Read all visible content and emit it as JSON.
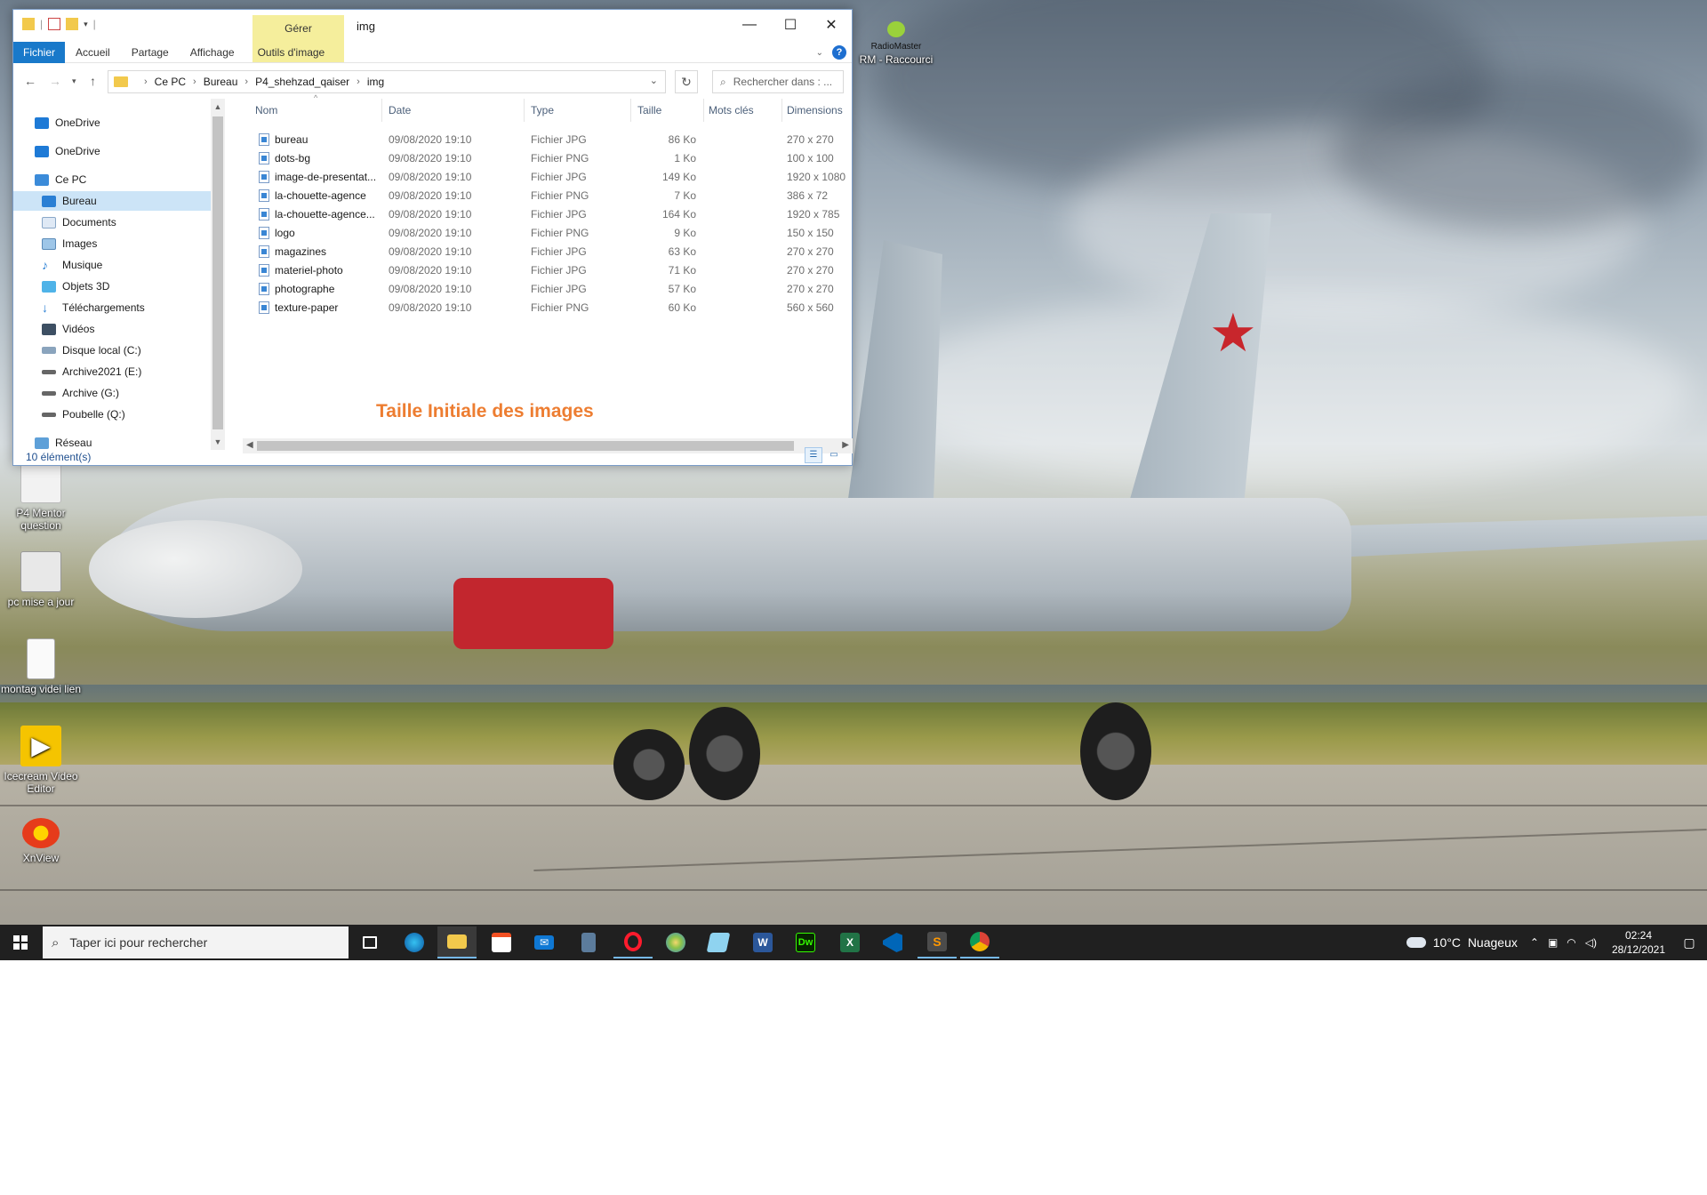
{
  "desktop": {
    "icons": [
      {
        "label": "RadioMaster",
        "sub": "RM - Raccourci"
      },
      {
        "label": "P4 Mentor question"
      },
      {
        "label": "pc mise a jour"
      },
      {
        "label": "montag videi lien"
      },
      {
        "label": "Icecream Video Editor"
      },
      {
        "label": "XnView"
      }
    ]
  },
  "explorer": {
    "title": "img",
    "context_tab": "Gérer",
    "ribbon_tabs": [
      "Fichier",
      "Accueil",
      "Partage",
      "Affichage",
      "Outils d'image"
    ],
    "address": {
      "crumbs": [
        "Ce PC",
        "Bureau",
        "P4_shehzad_qaiser",
        "img"
      ]
    },
    "search_placeholder": "Rechercher dans : ...",
    "nav_items": [
      {
        "label": "OneDrive",
        "icon": "onedrive-icon"
      },
      {
        "label": "OneDrive",
        "icon": "onedrive-icon"
      },
      {
        "label": "Ce PC",
        "icon": "this-pc-icon"
      },
      {
        "label": "Bureau",
        "icon": "desktop-folder-icon",
        "selected": true
      },
      {
        "label": "Documents",
        "icon": "documents-icon"
      },
      {
        "label": "Images",
        "icon": "pictures-icon"
      },
      {
        "label": "Musique",
        "icon": "music-icon"
      },
      {
        "label": "Objets 3D",
        "icon": "3d-objects-icon"
      },
      {
        "label": "Téléchargements",
        "icon": "downloads-icon"
      },
      {
        "label": "Vidéos",
        "icon": "videos-icon"
      },
      {
        "label": "Disque local (C:)",
        "icon": "local-disk-icon"
      },
      {
        "label": "Archive2021 (E:)",
        "icon": "drive-icon"
      },
      {
        "label": "Archive (G:)",
        "icon": "drive-icon"
      },
      {
        "label": "Poubelle (Q:)",
        "icon": "drive-icon"
      },
      {
        "label": "Réseau",
        "icon": "network-icon"
      }
    ],
    "columns": {
      "name": "Nom",
      "date": "Date",
      "type": "Type",
      "size": "Taille",
      "tags": "Mots clés",
      "dimensions": "Dimensions"
    },
    "files": [
      {
        "name": "bureau",
        "date": "09/08/2020 19:10",
        "type": "Fichier JPG",
        "size": "86 Ko",
        "dimensions": "270 x 270"
      },
      {
        "name": "dots-bg",
        "date": "09/08/2020 19:10",
        "type": "Fichier PNG",
        "size": "1 Ko",
        "dimensions": "100 x 100"
      },
      {
        "name": "image-de-presentat...",
        "date": "09/08/2020 19:10",
        "type": "Fichier JPG",
        "size": "149 Ko",
        "dimensions": "1920 x 1080"
      },
      {
        "name": "la-chouette-agence",
        "date": "09/08/2020 19:10",
        "type": "Fichier PNG",
        "size": "7 Ko",
        "dimensions": "386 x 72"
      },
      {
        "name": "la-chouette-agence...",
        "date": "09/08/2020 19:10",
        "type": "Fichier JPG",
        "size": "164 Ko",
        "dimensions": "1920 x 785"
      },
      {
        "name": "logo",
        "date": "09/08/2020 19:10",
        "type": "Fichier PNG",
        "size": "9 Ko",
        "dimensions": "150 x 150"
      },
      {
        "name": "magazines",
        "date": "09/08/2020 19:10",
        "type": "Fichier JPG",
        "size": "63 Ko",
        "dimensions": "270 x 270"
      },
      {
        "name": "materiel-photo",
        "date": "09/08/2020 19:10",
        "type": "Fichier JPG",
        "size": "71 Ko",
        "dimensions": "270 x 270"
      },
      {
        "name": "photographe",
        "date": "09/08/2020 19:10",
        "type": "Fichier JPG",
        "size": "57 Ko",
        "dimensions": "270 x 270"
      },
      {
        "name": "texture-paper",
        "date": "09/08/2020 19:10",
        "type": "Fichier PNG",
        "size": "60 Ko",
        "dimensions": "560 x 560"
      }
    ],
    "annotation": "Taille Initiale des images",
    "status": "10 élément(s)",
    "accent_color": "#1979ca",
    "annotation_color": "#ed7d31"
  },
  "taskbar": {
    "search_placeholder": "Taper ici pour rechercher",
    "apps": [
      "task-view",
      "edge",
      "file-explorer",
      "store",
      "mail",
      "calculator",
      "opera",
      "paint",
      "notepad",
      "word",
      "dreamweaver",
      "excel",
      "vscode",
      "sublime-text",
      "chrome"
    ],
    "weather": "10°C  Nuageux",
    "time": "02:24",
    "date": "28/12/2021"
  }
}
